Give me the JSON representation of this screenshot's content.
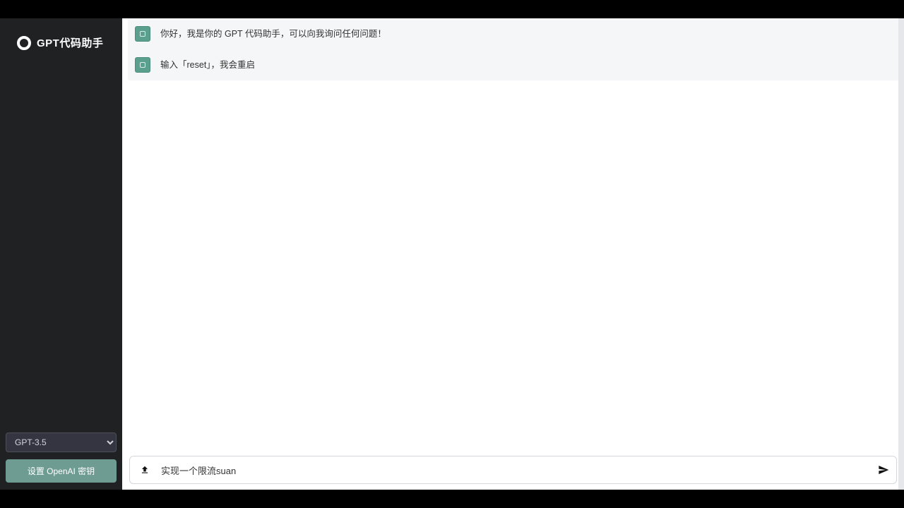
{
  "brand": {
    "title": "GPT代码助手"
  },
  "sidebar": {
    "model_selected": "GPT-3.5",
    "settings_label": "设置 OpenAI 密钥"
  },
  "messages": [
    {
      "text": "你好，我是你的 GPT 代码助手，可以向我询问任何问题！"
    },
    {
      "text": "输入「reset」，我会重启"
    }
  ],
  "input": {
    "value": "实现一个限流suan",
    "placeholder": ""
  }
}
